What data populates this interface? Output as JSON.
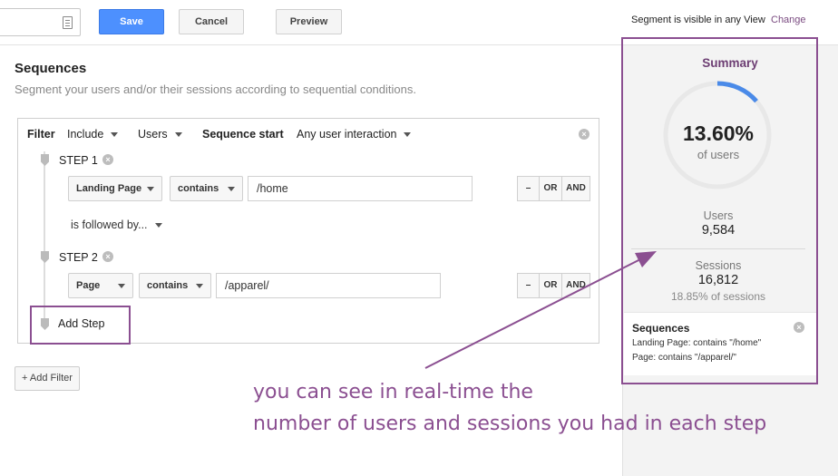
{
  "toolbar": {
    "save_label": "Save",
    "cancel_label": "Cancel",
    "preview_label": "Preview",
    "visibility_text": "Segment is visible in any View",
    "change_link": "Change"
  },
  "sequences": {
    "title": "Sequences",
    "subtitle": "Segment your users and/or their sessions according to sequential conditions.",
    "filter": {
      "filter_label": "Filter",
      "include_value": "Include",
      "scope_value": "Users",
      "sequence_start_label": "Sequence start",
      "sequence_start_value": "Any user interaction"
    },
    "steps": [
      {
        "label": "STEP 1",
        "dimension": "Landing Page",
        "operator": "contains",
        "value": "/home"
      },
      {
        "label": "STEP 2",
        "dimension": "Page",
        "operator": "contains",
        "value": "/apparel/"
      }
    ],
    "followed_by": "is followed by...",
    "logic_buttons": {
      "minus": "–",
      "or": "OR",
      "and": "AND"
    },
    "add_step_label": "Add Step",
    "add_filter_label": "+ Add Filter"
  },
  "summary": {
    "title": "Summary",
    "percent": "13.60%",
    "percent_fraction": 0.136,
    "percent_label": "of users",
    "users_label": "Users",
    "users_value": "9,584",
    "sessions_label": "Sessions",
    "sessions_value": "16,812",
    "sessions_pct": "18.85% of sessions",
    "donut_color": "#4a8ae8",
    "track_color": "#e8e8e8",
    "sequences_card": {
      "title": "Sequences",
      "line1": "Landing Page: contains \"/home\"",
      "line2": "Page: contains \"/apparel/\""
    }
  },
  "annotation": {
    "line1": "you can see in real-time the",
    "line2": "number of users and sessions you had in each step",
    "color": "#8b4f91"
  }
}
